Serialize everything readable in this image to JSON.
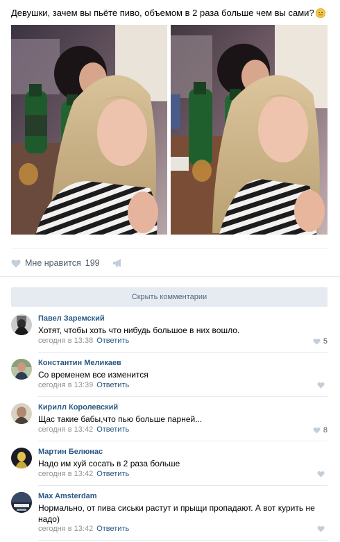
{
  "post": {
    "text": "Девушки, зачем вы пьёте пиво, объемом в 2 раза больше чем вы сами?"
  },
  "likes": {
    "label": "Мне нравится",
    "count": "199"
  },
  "comments_toggle": "Скрыть комментарии",
  "comments": [
    {
      "author": "Павел Заремский",
      "text": "Хотят, чтобы хоть что нибудь большое в них вошло.",
      "time": "сегодня в 13:38",
      "reply": "Ответить",
      "likes": "5"
    },
    {
      "author": "Константин Меликаев",
      "text": "Со временем все изменится",
      "time": "сегодня в 13:39",
      "reply": "Ответить",
      "likes": ""
    },
    {
      "author": "Кирилл Королевский",
      "text": "Щас такие бабы,что пью больше парней...",
      "time": "сегодня в 13:42",
      "reply": "Ответить",
      "likes": "8"
    },
    {
      "author": "Мартин Белюнас",
      "text": "Надо им хуй сосать в 2 раза больше",
      "time": "сегодня в 13:42",
      "reply": "Ответить",
      "likes": ""
    },
    {
      "author": "Max Amsterdam",
      "text": "Нормально, от пива сиськи растут и прыщи пропадают. А вот курить не надо)",
      "time": "сегодня в 13:42",
      "reply": "Ответить",
      "likes": ""
    }
  ],
  "colors": {
    "link": "#2a5885",
    "meta": "#939393",
    "button_bg": "#e5ebf1",
    "separator": "#e7e8ec"
  }
}
